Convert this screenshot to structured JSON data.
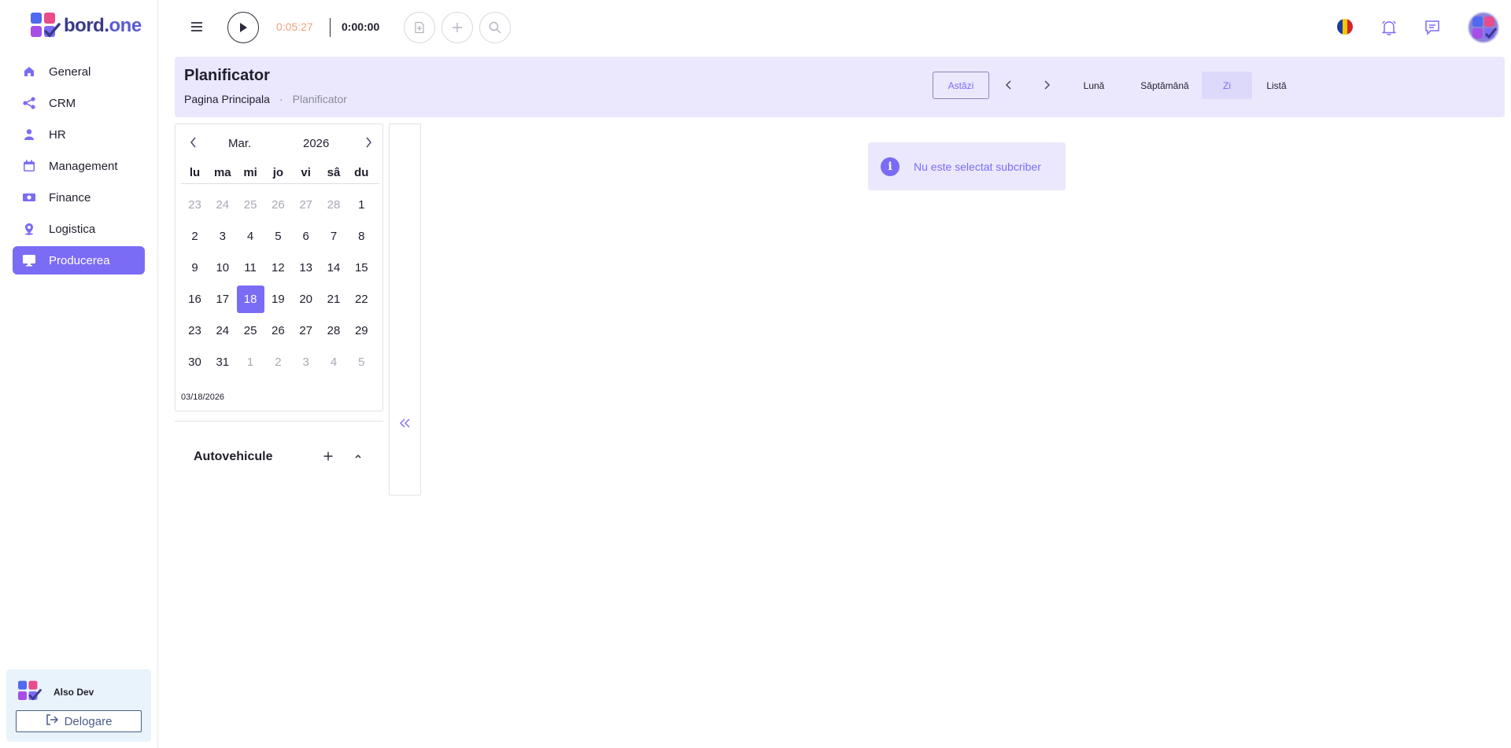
{
  "app": {
    "brand_main": "bord.",
    "brand_accent": "one"
  },
  "sidebar": {
    "items": [
      {
        "label": "General",
        "icon": "home-icon",
        "active": false
      },
      {
        "label": "CRM",
        "icon": "share-icon",
        "active": false
      },
      {
        "label": "HR",
        "icon": "person-icon",
        "active": false
      },
      {
        "label": "Management",
        "icon": "calendar-icon",
        "active": false
      },
      {
        "label": "Finance",
        "icon": "money-icon",
        "active": false
      },
      {
        "label": "Logistica",
        "icon": "location-icon",
        "active": false
      },
      {
        "label": "Producerea",
        "icon": "monitor-icon",
        "active": true
      }
    ],
    "user_name": "Also Dev",
    "logout_label": "Delogare"
  },
  "topbar": {
    "timer_elapsed": "0:05:27",
    "timer_current": "0:00:00"
  },
  "header": {
    "title": "Planificator",
    "breadcrumb_home": "Pagina Principala",
    "breadcrumb_sep": "·",
    "breadcrumb_current": "Planificator",
    "today_label": "Astăzi",
    "views": [
      "Lună",
      "Săptămână",
      "Zi",
      "Listă"
    ],
    "active_view": "Zi"
  },
  "calendar": {
    "month": "Mar.",
    "year": "2026",
    "weekdays": [
      "lu",
      "ma",
      "mi",
      "jo",
      "vi",
      "sâ",
      "du"
    ],
    "weeks": [
      [
        {
          "d": "23",
          "m": true
        },
        {
          "d": "24",
          "m": true
        },
        {
          "d": "25",
          "m": true
        },
        {
          "d": "26",
          "m": true
        },
        {
          "d": "27",
          "m": true
        },
        {
          "d": "28",
          "m": true
        },
        {
          "d": "1",
          "m": false
        }
      ],
      [
        {
          "d": "2",
          "m": false
        },
        {
          "d": "3",
          "m": false
        },
        {
          "d": "4",
          "m": false
        },
        {
          "d": "5",
          "m": false
        },
        {
          "d": "6",
          "m": false
        },
        {
          "d": "7",
          "m": false
        },
        {
          "d": "8",
          "m": false
        }
      ],
      [
        {
          "d": "9",
          "m": false
        },
        {
          "d": "10",
          "m": false
        },
        {
          "d": "11",
          "m": false
        },
        {
          "d": "12",
          "m": false
        },
        {
          "d": "13",
          "m": false
        },
        {
          "d": "14",
          "m": false
        },
        {
          "d": "15",
          "m": false
        }
      ],
      [
        {
          "d": "16",
          "m": false
        },
        {
          "d": "17",
          "m": false
        },
        {
          "d": "18",
          "m": false,
          "sel": true
        },
        {
          "d": "19",
          "m": false
        },
        {
          "d": "20",
          "m": false
        },
        {
          "d": "21",
          "m": false
        },
        {
          "d": "22",
          "m": false
        }
      ],
      [
        {
          "d": "23",
          "m": false
        },
        {
          "d": "24",
          "m": false
        },
        {
          "d": "25",
          "m": false
        },
        {
          "d": "26",
          "m": false
        },
        {
          "d": "27",
          "m": false
        },
        {
          "d": "28",
          "m": false
        },
        {
          "d": "29",
          "m": false
        }
      ],
      [
        {
          "d": "30",
          "m": false
        },
        {
          "d": "31",
          "m": false
        },
        {
          "d": "1",
          "m": true
        },
        {
          "d": "2",
          "m": true
        },
        {
          "d": "3",
          "m": true
        },
        {
          "d": "4",
          "m": true
        },
        {
          "d": "5",
          "m": true
        }
      ]
    ],
    "selected_date": "03/18/2026"
  },
  "vehicles": {
    "title": "Autovehicule"
  },
  "alert": {
    "text": "Nu este selectat subcriber"
  },
  "colors": {
    "accent": "#7b6cf6",
    "band": "#ebe8fd",
    "timer": "#f2a07b"
  }
}
